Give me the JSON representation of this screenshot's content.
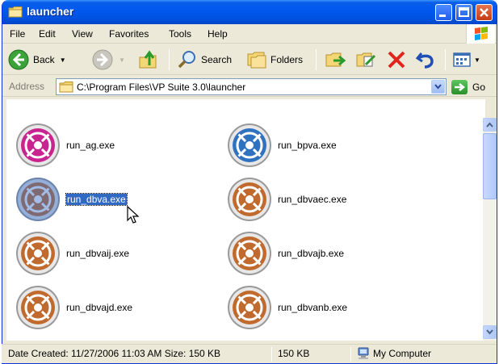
{
  "window": {
    "title": "launcher",
    "title_icon": "folder-icon",
    "controls": [
      "minimize-icon",
      "maximize-icon",
      "close-icon"
    ]
  },
  "menu": {
    "items": [
      "File",
      "Edit",
      "View",
      "Favorites",
      "Tools",
      "Help"
    ]
  },
  "toolbar": {
    "back_label": "Back",
    "search_label": "Search",
    "folders_label": "Folders",
    "icons": [
      "back-arrow-icon",
      "forward-arrow-icon",
      "up-folder-icon",
      "search-icon",
      "folders-icon",
      "move-to-icon",
      "copy-to-icon",
      "delete-icon",
      "undo-icon",
      "views-icon"
    ]
  },
  "address": {
    "label": "Address",
    "value": "C:\\Program Files\\VP Suite 3.0\\launcher",
    "go_label": "Go"
  },
  "files": [
    {
      "name": "run_ag.exe",
      "color": "#c8238f"
    },
    {
      "name": "run_bpva.exe",
      "color": "#2f73c0"
    },
    {
      "name": "run_dbva.exe",
      "color": "#c06a2e",
      "selected": true
    },
    {
      "name": "run_dbvaec.exe",
      "color": "#c06a2e"
    },
    {
      "name": "run_dbvaij.exe",
      "color": "#c06a2e"
    },
    {
      "name": "run_dbvajb.exe",
      "color": "#c06a2e"
    },
    {
      "name": "run_dbvajd.exe",
      "color": "#c06a2e"
    },
    {
      "name": "run_dbvanb.exe",
      "color": "#c06a2e"
    }
  ],
  "status": {
    "info": "Date Created: 11/27/2006 11:03 AM Size: 150 KB",
    "size": "150 KB",
    "location": "My Computer"
  },
  "colors": {
    "titlebar": "#0054e3",
    "selection": "#316ac5",
    "window_bg": "#ece9d8"
  }
}
